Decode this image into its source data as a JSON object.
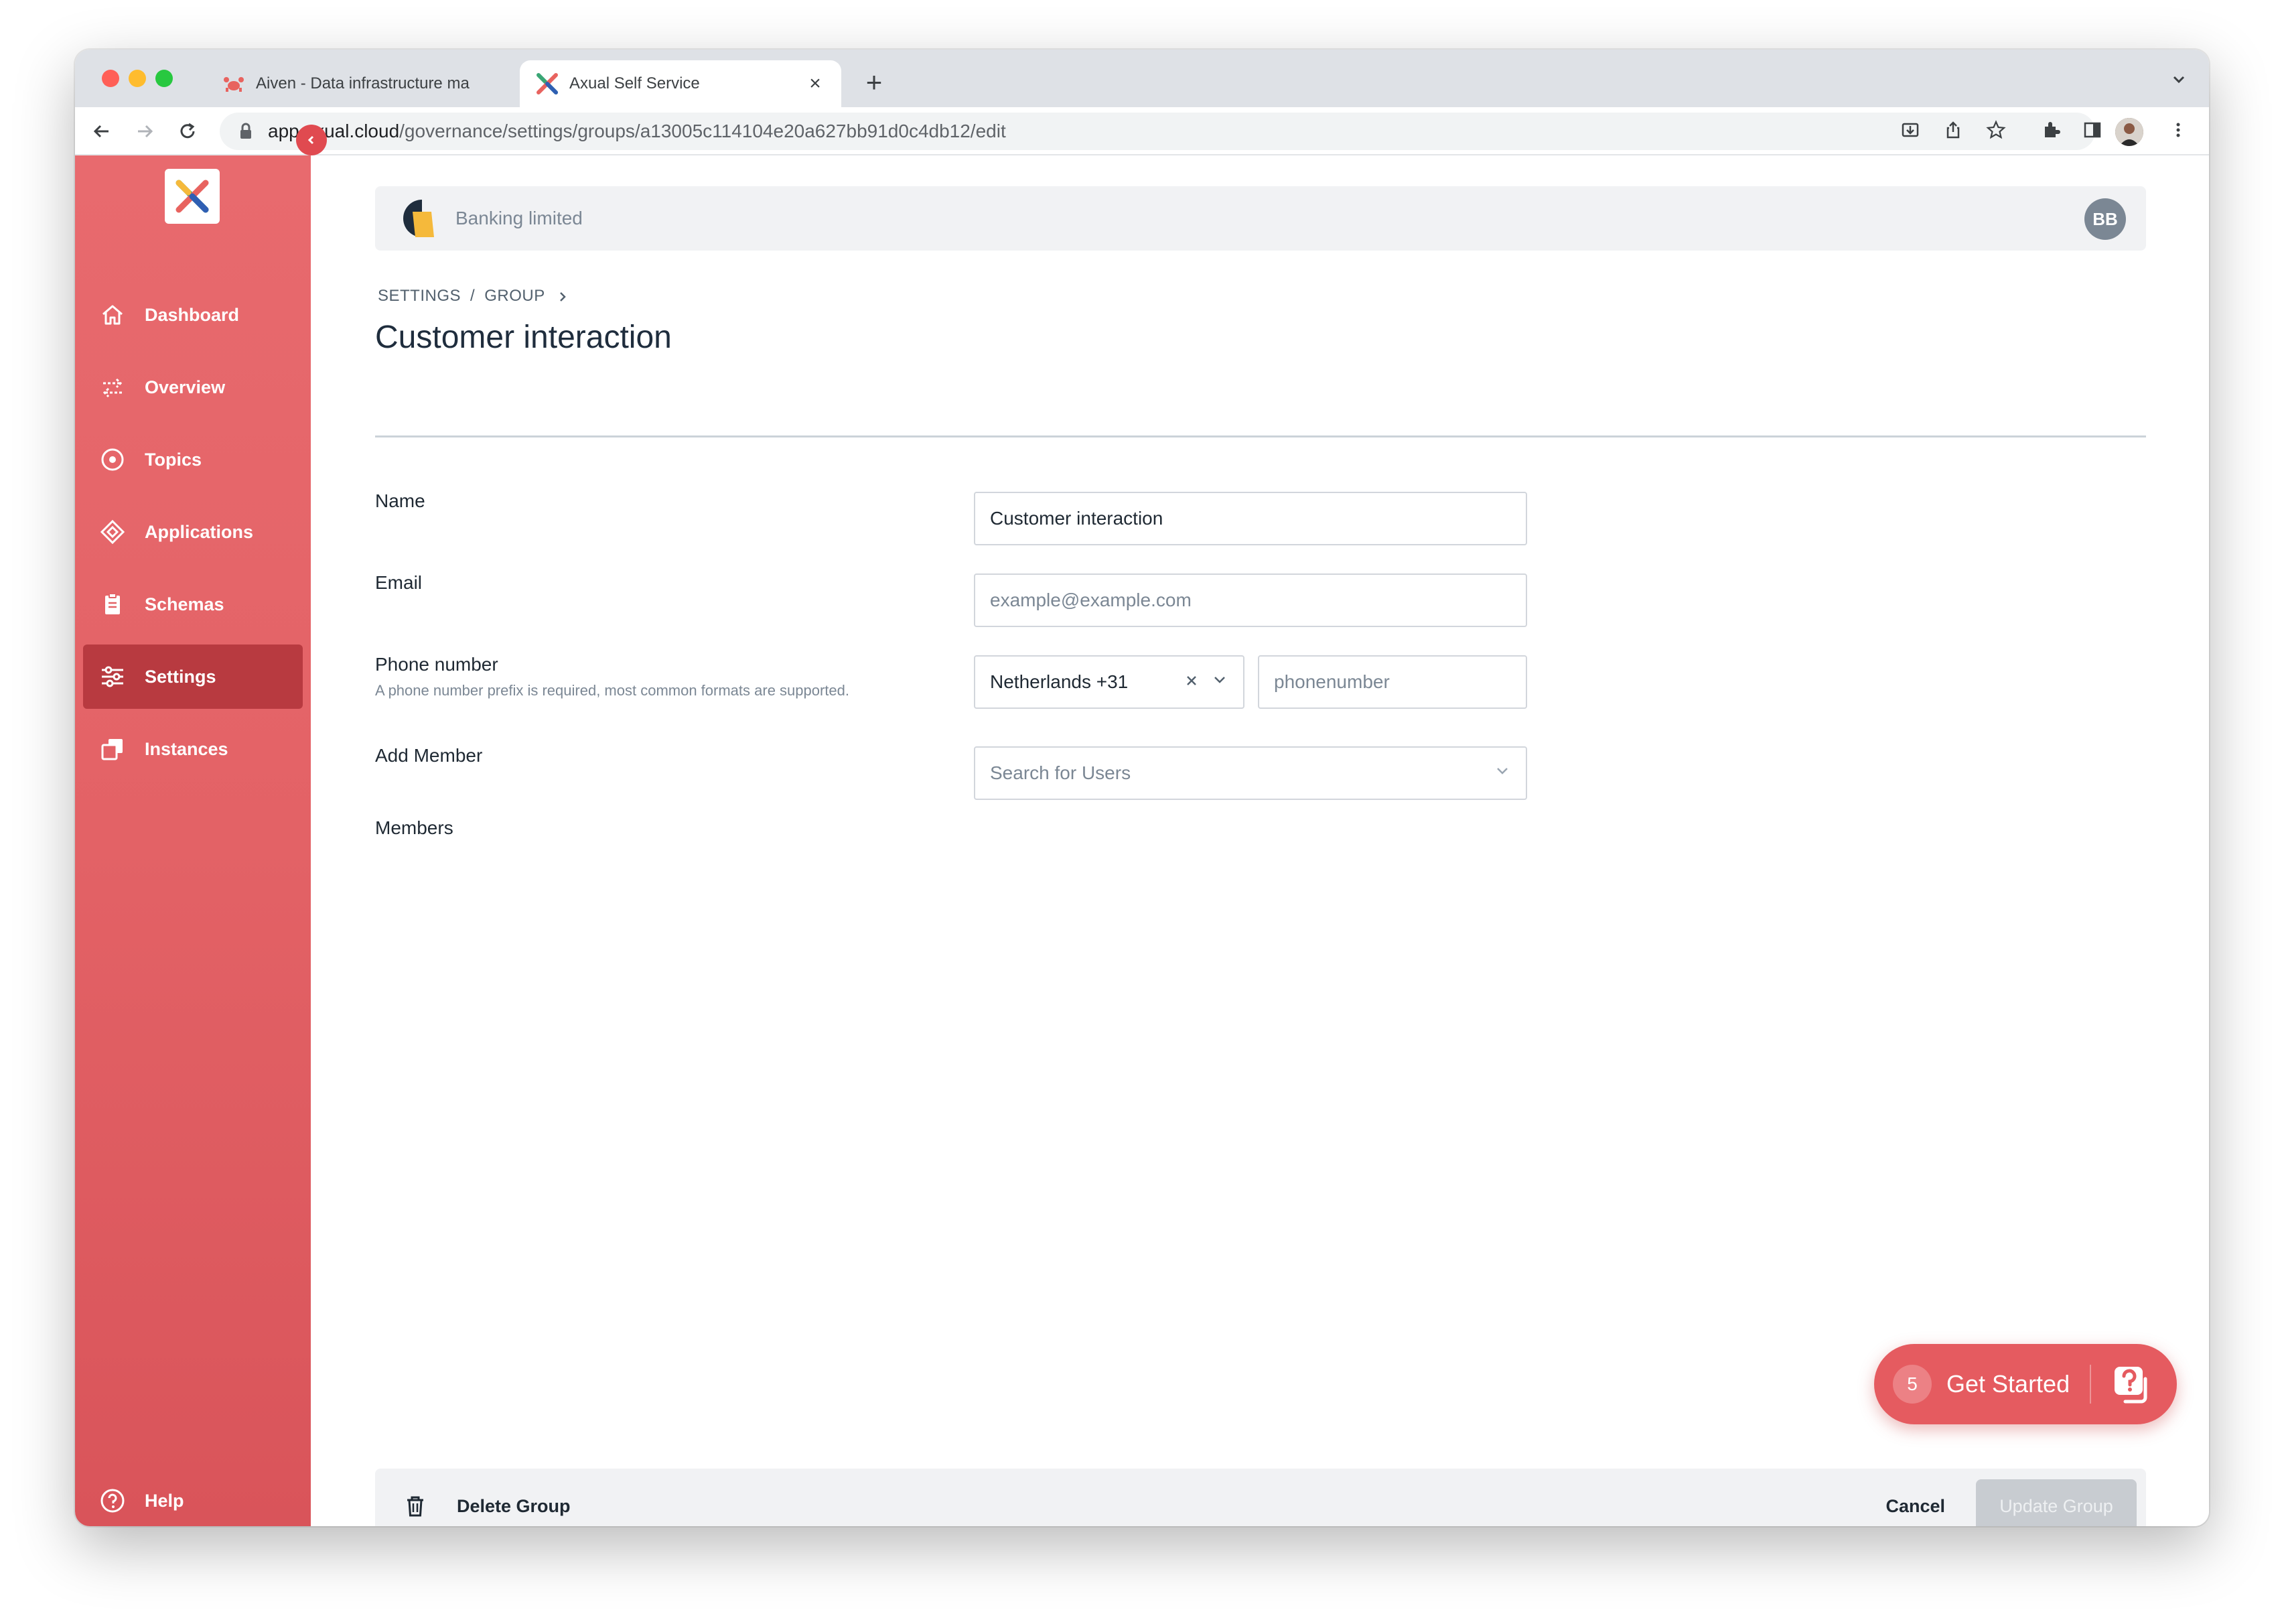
{
  "browser": {
    "tabs": [
      {
        "title": "Aiven - Data infrastructure ma",
        "active": false
      },
      {
        "title": "Axual Self Service",
        "active": true
      }
    ],
    "url_host": "app.axual.cloud",
    "url_path": "/governance/settings/groups/a13005c114104e20a627bb91d0c4db12/edit"
  },
  "sidebar": {
    "items": [
      {
        "label": "Dashboard",
        "icon": "home-icon",
        "active": false
      },
      {
        "label": "Overview",
        "icon": "arrows-icon",
        "active": false
      },
      {
        "label": "Topics",
        "icon": "target-icon",
        "active": false
      },
      {
        "label": "Applications",
        "icon": "diamond-icon",
        "active": false
      },
      {
        "label": "Schemas",
        "icon": "clipboard-icon",
        "active": false
      },
      {
        "label": "Settings",
        "icon": "sliders-icon",
        "active": true
      },
      {
        "label": "Instances",
        "icon": "copy-icon",
        "active": false
      }
    ],
    "help_label": "Help"
  },
  "header": {
    "org_name": "Banking limited",
    "user_initials": "BB"
  },
  "breadcrumb": {
    "items": [
      "SETTINGS",
      "GROUP"
    ],
    "separator": "/"
  },
  "page_title": "Customer interaction",
  "form": {
    "name_label": "Name",
    "name_value": "Customer interaction",
    "email_label": "Email",
    "email_placeholder": "example@example.com",
    "phone_label": "Phone number",
    "phone_hint": "A phone number prefix is required, most common formats are supported.",
    "country_value": "Netherlands +31",
    "phone_placeholder": "phonenumber",
    "add_member_label": "Add Member",
    "search_users_placeholder": "Search for Users",
    "members_label": "Members"
  },
  "footer": {
    "delete_label": "Delete Group",
    "cancel_label": "Cancel",
    "update_label": "Update Group"
  },
  "get_started": {
    "count": "5",
    "label": "Get Started"
  },
  "colors": {
    "accent": "#e36266",
    "sidebar_active": "#b83a40",
    "title": "#1f2d3d"
  }
}
